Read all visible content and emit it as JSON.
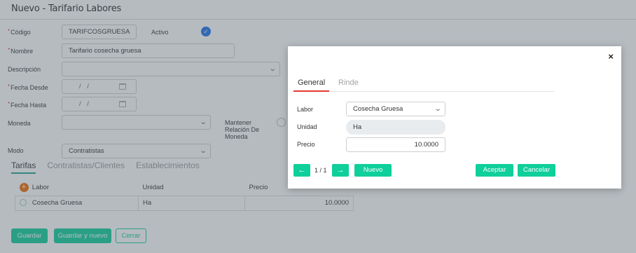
{
  "page": {
    "title": "Nuevo - Tarifario Labores"
  },
  "form": {
    "codigo_label": "Código",
    "codigo_value": "TARIFCOSGRUESA",
    "activo_label": "Activo",
    "nombre_label": "Nombre",
    "nombre_value": "Tarifario cosecha gruesa",
    "descripcion_label": "Descripción",
    "descripcion_value": "",
    "fecha_desde_label": "Fecha Desde",
    "fecha_desde_value": "/ /",
    "fecha_hasta_label": "Fecha Hasta",
    "fecha_hasta_value": "/ /",
    "moneda_label": "Moneda",
    "moneda_value": "",
    "mantener_label_1": "Mantener",
    "mantener_label_2": "Relación De",
    "mantener_label_3": "Moneda",
    "modo_label": "Modo",
    "modo_value": "Contratistas",
    "required_marker": "*"
  },
  "tabs": [
    "Tarifas",
    "Contratistas/Clientes",
    "Establecimientos"
  ],
  "tarifas_table": {
    "columns": [
      "Labor",
      "Unidad",
      "Precio"
    ],
    "rows": [
      {
        "labor": "Cosecha Gruesa",
        "unidad": "Ha",
        "precio": "10.0000"
      }
    ]
  },
  "footer_buttons": {
    "guardar": "Guardar",
    "guardar_nuevo": "Guardar y nuevo",
    "cerrar": "Cerrar"
  },
  "modal": {
    "close_glyph": "×",
    "tabs": [
      "General",
      "Rinde"
    ],
    "labor_label": "Labor",
    "labor_value": "Cosecha Gruesa",
    "unidad_label": "Unidad",
    "unidad_value": "Ha",
    "precio_label": "Precio",
    "precio_value": "10.0000",
    "prev_glyph": "←",
    "next_glyph": "→",
    "pager": "1 / 1",
    "nuevo": "Nuevo",
    "aceptar": "Aceptar",
    "cancelar": "Cancelar"
  },
  "colors": {
    "accent": "#0fcf9b",
    "tab_active": "#e53935",
    "check": "#1a73e8",
    "overlay": "rgba(80,92,104,0.42)"
  },
  "icons": {
    "activo": "check-circle-icon",
    "add_row": "plus-circle-icon",
    "close": "close-icon",
    "dropdown": "chevron-down-icon",
    "calendar": "calendar-icon",
    "prev": "arrow-left-icon",
    "next": "arrow-right-icon"
  }
}
